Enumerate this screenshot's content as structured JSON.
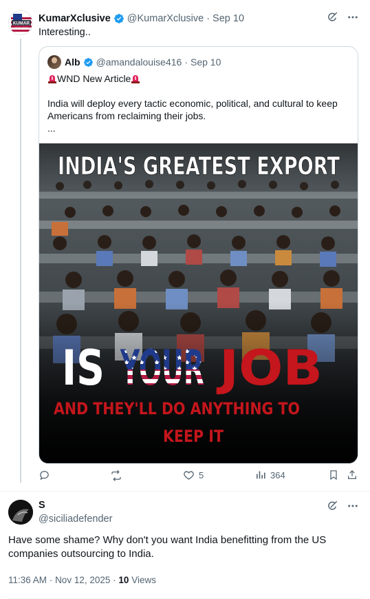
{
  "tweet": {
    "author_name": "KumarXclusive",
    "avatar_text": "KUMAR",
    "avatar_subtext": "EXCLUSIVE",
    "handle": "@KumarXclusive",
    "date": "Sep 10",
    "text": "Interesting..",
    "quote": {
      "author_name": "Alb",
      "handle": "@amandalouise416",
      "date": "Sep 10",
      "title": "WND New Article",
      "body": "India will deploy every tactic economic, political, and cultural to keep Americans from reclaiming their jobs.",
      "ellipsis": "...",
      "image": {
        "headline": "INDIA'S GREATEST EXPORT",
        "is_word": "IS",
        "your_word": "YOUR",
        "job_word": "JOB",
        "tagline_1": "AND THEY'LL DO ANYTHING TO",
        "tagline_2": "KEEP IT"
      }
    },
    "actions": {
      "reply_count": "",
      "repost_count": "",
      "like_count": "5",
      "views_count": "364"
    }
  },
  "reply": {
    "author_name": "S",
    "handle": "@siciliadefender",
    "text": "Have some shame? Why don't you want India benefitting from the US companies outsourcing to India.",
    "time": "11:36 AM",
    "date": "Nov 12, 2025",
    "views_count": "10",
    "views_label": "Views"
  },
  "colors": {
    "verified": "#1d9bf0",
    "muted": "#536471",
    "tagline_red": "#c4161c",
    "flag_blue": "#1f3a8a",
    "flag_red": "#b31942"
  }
}
